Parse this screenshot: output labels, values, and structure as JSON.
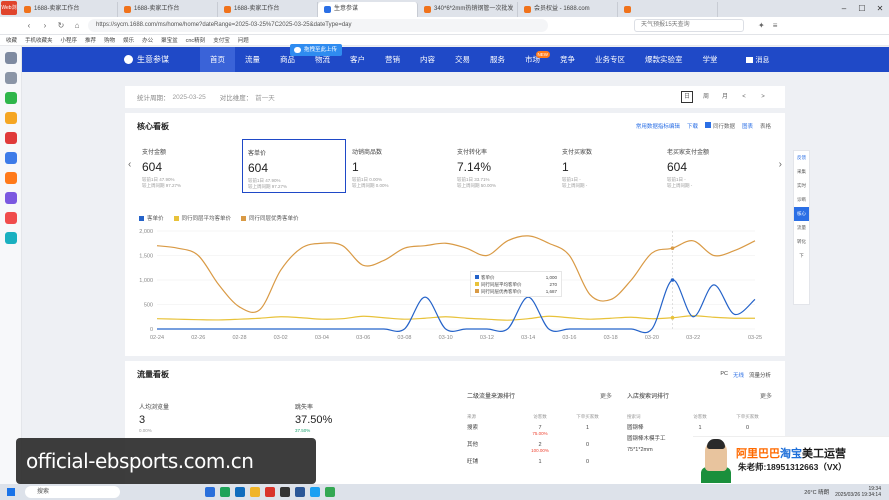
{
  "browser": {
    "logo_text": "Web浏览器",
    "tabs": [
      {
        "label": "1688-卖家工作台",
        "active": false
      },
      {
        "label": "1688-卖家工作台",
        "active": false
      },
      {
        "label": "1688-卖家工作台",
        "active": false
      },
      {
        "label": "生意参谋",
        "active": true
      },
      {
        "label": "340*6*2mm热销钢管一次批发",
        "active": false
      },
      {
        "label": "会员权益 - 1688.com",
        "active": false
      },
      {
        "label": "",
        "active": false
      }
    ],
    "url": "https://sycm.1688.com/ms/home/home?dateRange=2025-03-25%7C2025-03-25&dateType=day",
    "search_placeholder": "天气预报15天查询",
    "bookmarks": [
      "收藏",
      "手机收藏夹",
      "小程序",
      "推荐",
      "购物",
      "娱乐",
      "办公",
      "聚宝盆",
      "cnc精刻",
      "支付宝",
      "问题"
    ]
  },
  "upload_tip": "拖拽至此上传",
  "nav": {
    "brand": "生意参谋",
    "items": [
      {
        "label": "首页",
        "active": true,
        "badge": ""
      },
      {
        "label": "流量",
        "active": false,
        "badge": ""
      },
      {
        "label": "商品",
        "active": false,
        "badge": ""
      },
      {
        "label": "物流",
        "active": false,
        "badge": ""
      },
      {
        "label": "客户",
        "active": false,
        "badge": ""
      },
      {
        "label": "营销",
        "active": false,
        "badge": ""
      },
      {
        "label": "内容",
        "active": false,
        "badge": ""
      },
      {
        "label": "交易",
        "active": false,
        "badge": ""
      },
      {
        "label": "服务",
        "active": false,
        "badge": ""
      },
      {
        "label": "市场",
        "active": false,
        "badge": "NEW"
      },
      {
        "label": "竞争",
        "active": false,
        "badge": ""
      },
      {
        "label": "业务专区",
        "active": false,
        "badge": ""
      },
      {
        "label": "爆款实验室",
        "active": false,
        "badge": ""
      },
      {
        "label": "学堂",
        "active": false,
        "badge": ""
      }
    ],
    "user_label": "消息"
  },
  "period": {
    "stat_label": "统计周期：",
    "stat_value": "2025-03-25",
    "compare_label": "对比维度：",
    "compare_value": "前一天",
    "buttons": [
      "日",
      "周",
      "月",
      "<",
      ">"
    ]
  },
  "core": {
    "title": "核心看板",
    "tools": [
      "常用数据指标编辑",
      "下载",
      "同行数据",
      "图表",
      "表格"
    ],
    "metrics": [
      {
        "name": "支付金额",
        "value": "604",
        "sub1": "较前1日 47.90%",
        "sub2": "较上周同期 97.27%",
        "selected": false
      },
      {
        "name": "客单价",
        "value": "604",
        "sub1": "较前1日 47.90%",
        "sub2": "较上周同期 97.27%",
        "selected": true
      },
      {
        "name": "动销商品数",
        "value": "1",
        "sub1": "较前1日 0.00%",
        "sub2": "较上周同期 0.00%",
        "selected": false
      },
      {
        "name": "支付转化率",
        "value": "7.14%",
        "sub1": "较前1日 33.71%",
        "sub2": "较上周同期 50.00%",
        "selected": false
      },
      {
        "name": "支付买家数",
        "value": "1",
        "sub1": "较前1日 -",
        "sub2": "较上周同期 -",
        "selected": false
      },
      {
        "name": "老买家支付金额",
        "value": "604",
        "sub1": "较前1日 -",
        "sub2": "较上周同期 -",
        "selected": false
      }
    ],
    "legend": [
      {
        "name": "客单价",
        "color": "#2563c9"
      },
      {
        "name": "同行同层平均客单价",
        "color": "#e8c23a"
      },
      {
        "name": "同行同层优秀客单价",
        "color": "#d99a45"
      }
    ]
  },
  "chart_data": {
    "type": "line",
    "x": [
      "02-24",
      "02-25",
      "02-26",
      "02-27",
      "02-28",
      "03-01",
      "03-02",
      "03-03",
      "03-04",
      "03-05",
      "03-06",
      "03-07",
      "03-08",
      "03-09",
      "03-10",
      "03-11",
      "03-12",
      "03-13",
      "03-14",
      "03-15",
      "03-16",
      "03-17",
      "03-18",
      "03-19",
      "03-20",
      "03-21",
      "03-22",
      "03-23",
      "03-24",
      "03-25"
    ],
    "tick_labels": [
      "02-24",
      "02-26",
      "02-28",
      "03-02",
      "03-04",
      "03-06",
      "03-08",
      "03-10",
      "03-12",
      "03-14",
      "03-16",
      "03-18",
      "03-20",
      "03-22",
      "03-25"
    ],
    "y_ticks": [
      "0",
      "500",
      "1,000",
      "1,500",
      "2,000"
    ],
    "ylim": [
      0,
      2000
    ],
    "series": [
      {
        "name": "客单价",
        "color": "#2563c9",
        "values": [
          0,
          0,
          0,
          0,
          0,
          0,
          0,
          0,
          0,
          0,
          0,
          0,
          0,
          650,
          0,
          0,
          0,
          0,
          650,
          0,
          0,
          0,
          0,
          0,
          0,
          1000,
          250,
          900,
          300,
          604
        ]
      },
      {
        "name": "同行同层平均客单价",
        "color": "#e8c23a",
        "values": [
          210,
          200,
          190,
          185,
          200,
          220,
          250,
          230,
          200,
          210,
          260,
          230,
          200,
          220,
          250,
          220,
          200,
          180,
          210,
          260,
          230,
          200,
          220,
          240,
          210,
          230,
          270,
          240,
          220,
          220
        ]
      },
      {
        "name": "同行同层优秀客单价",
        "color": "#d99a45",
        "values": [
          1700,
          1650,
          1500,
          900,
          450,
          400,
          1200,
          1650,
          1750,
          1700,
          1300,
          1400,
          1650,
          1700,
          1750,
          1650,
          1500,
          1800,
          1900,
          1750,
          1500,
          700,
          600,
          1000,
          1550,
          1650,
          1800,
          1500,
          1600,
          1800
        ]
      }
    ],
    "tooltip": {
      "rows": [
        {
          "name": "客单价",
          "value": "1,000",
          "color": "#2563c9"
        },
        {
          "name": "同行同层平均客单价",
          "value": "270",
          "color": "#e8c23a"
        },
        {
          "name": "同行同层优秀客单价",
          "value": "1,687",
          "color": "#d99a45"
        }
      ]
    }
  },
  "flow": {
    "title": "流量看板",
    "tools": [
      "PC",
      "无线",
      "流量分析"
    ],
    "metrics": [
      {
        "name": "人均浏览量",
        "value": "3",
        "sub": "0.00%"
      },
      {
        "name": "跳失率",
        "value": "37.50%",
        "sub": "37.50%"
      }
    ],
    "rank1": {
      "title": "二级流量来源排行",
      "more": "更多",
      "head": [
        "来源",
        "访客数",
        "下单买家数"
      ],
      "rows": [
        {
          "name": "搜索",
          "v1": "7",
          "v1sub": "75.00%",
          "v2": "1"
        },
        {
          "name": "其他",
          "v1": "2",
          "v1sub": "100.00%",
          "v2": "0"
        },
        {
          "name": "旺铺",
          "v1": "1",
          "v1sub": "",
          "v2": "0"
        }
      ]
    },
    "rank2": {
      "title": "入店搜索词排行",
      "more": "更多",
      "head": [
        "搜索词",
        "访客数",
        "下单买家数"
      ],
      "rows": [
        {
          "name": "圆钢棒",
          "v1": "1",
          "v1sub": "",
          "v2": "0"
        },
        {
          "name": "圆钢棒木模手工",
          "v1": "1",
          "v1sub": "",
          "v2": "0"
        },
        {
          "name": "75*1*2mm",
          "v1": "1",
          "v1sub": "",
          "v2": "0"
        }
      ]
    }
  },
  "right_tools": [
    "反馈",
    "采集",
    "实时",
    "诊断",
    "核心",
    "流量",
    "转化",
    "下"
  ],
  "ad": {
    "line1_a": "阿里巴巴",
    "line1_b": "淘宝",
    "line1_c": "美工运营",
    "line2": "朱老师:18951312663（VX）"
  },
  "watermark": "official-ebsports.com.cn",
  "taskbar": {
    "search": "搜索",
    "weather": "26°C 晴朗",
    "time": "19:34",
    "date": "2025/03/26 19:34:14"
  }
}
